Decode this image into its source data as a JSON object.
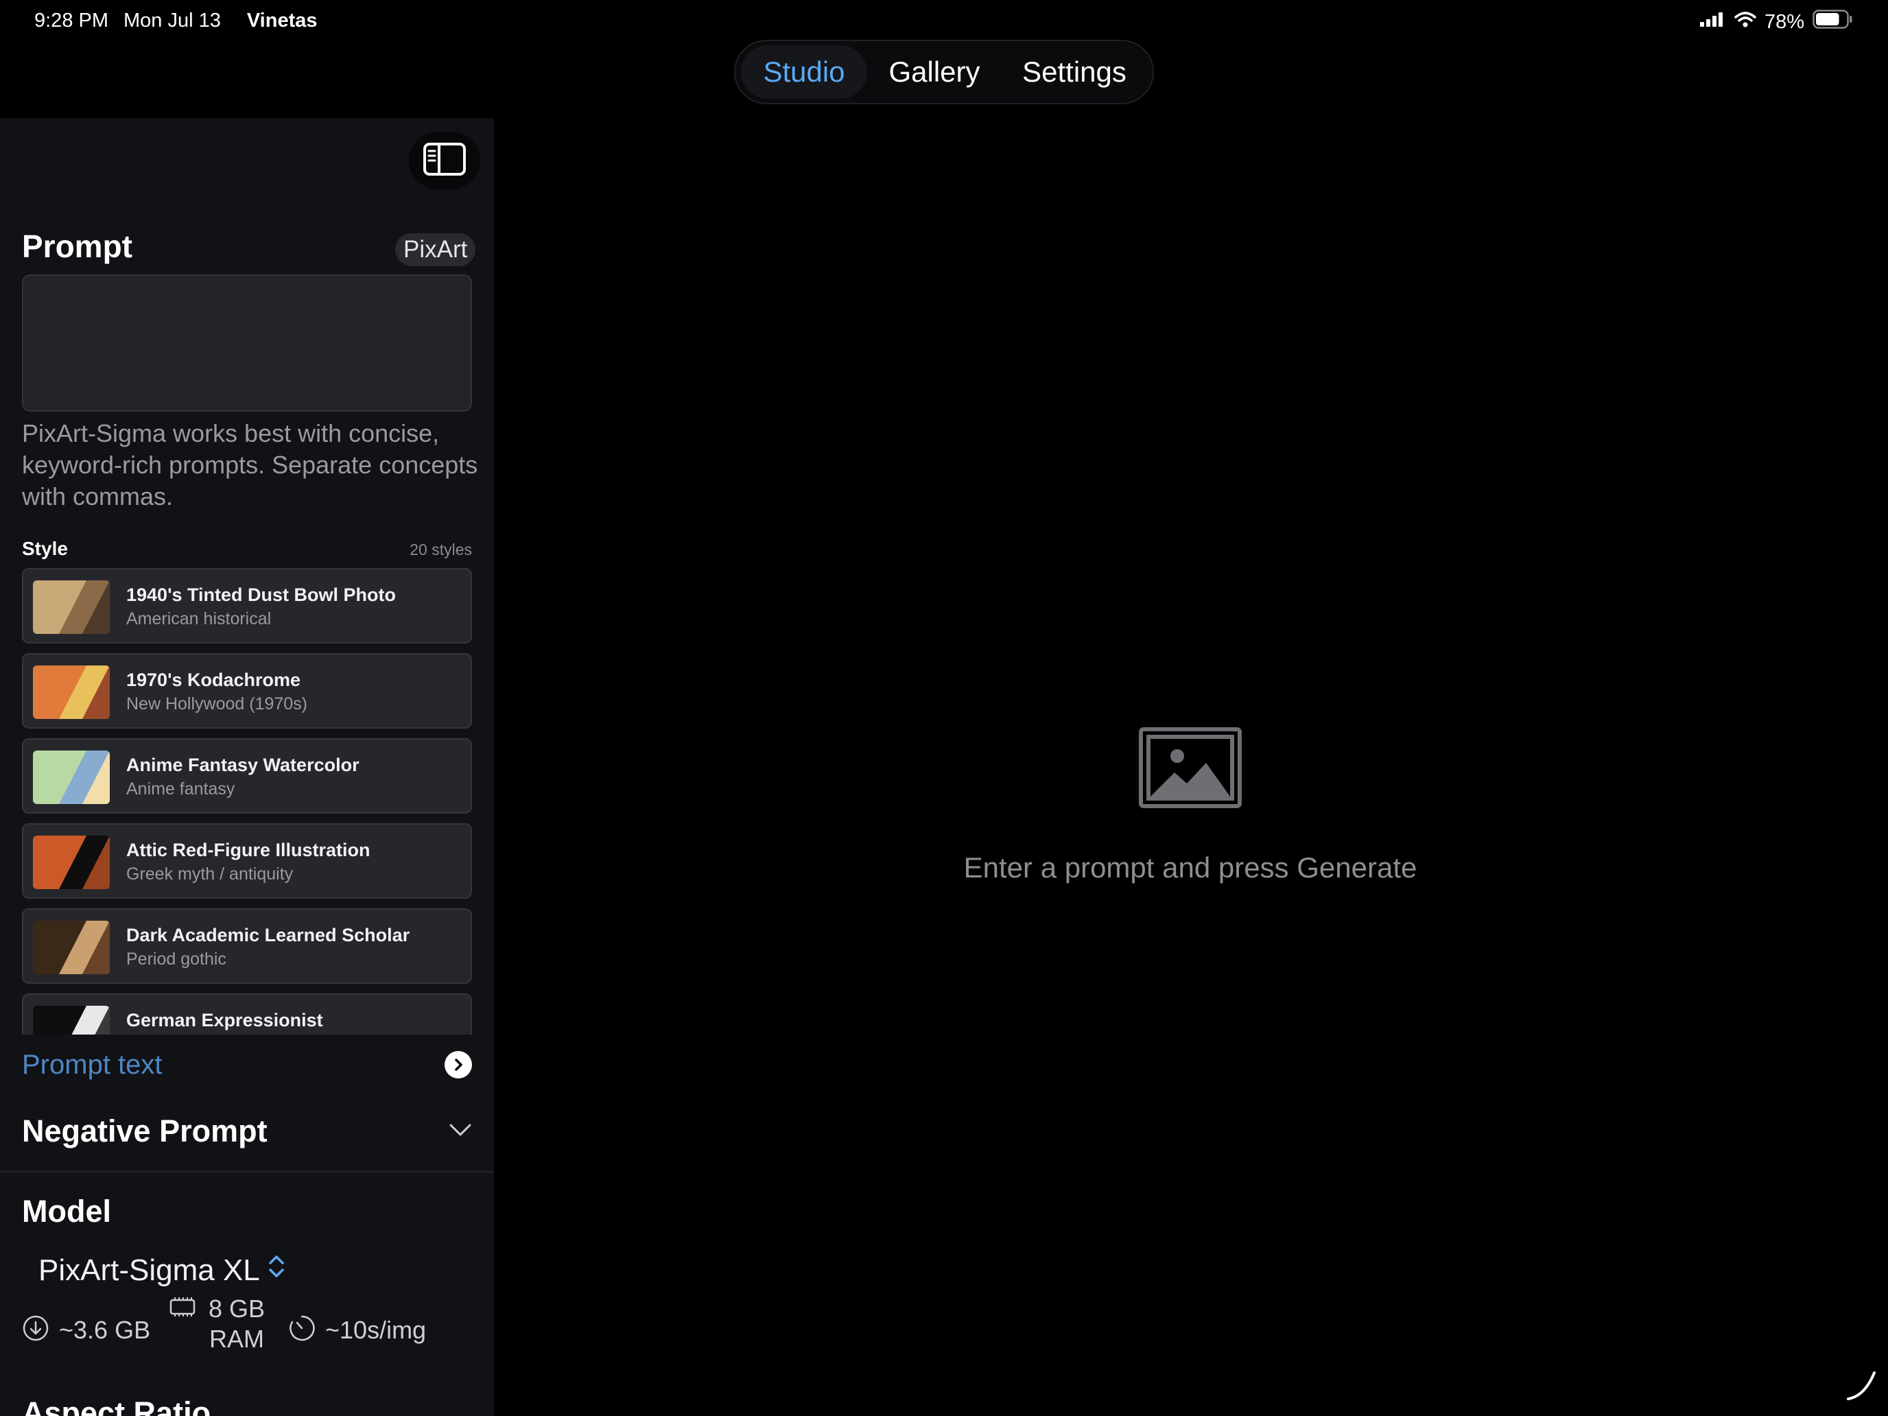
{
  "status_bar": {
    "time": "9:28 PM",
    "date": "Mon Jul 13",
    "app": "Vinetas",
    "battery": "78%",
    "battery_level": 0.78
  },
  "nav": {
    "tabs": [
      {
        "label": "Studio",
        "active": true
      },
      {
        "label": "Gallery",
        "active": false
      },
      {
        "label": "Settings",
        "active": false
      }
    ]
  },
  "sidebar": {
    "prompt": {
      "title": "Prompt",
      "badge": "PixArt",
      "value": "",
      "placeholder": "",
      "hint": "PixArt-Sigma works best with concise, keyword-rich prompts. Separate concepts with commas."
    },
    "style": {
      "label": "Style",
      "count": "20 styles",
      "items": [
        {
          "name": "1940's Tinted Dust Bowl Photo",
          "subtitle": "American historical",
          "colors": [
            "#c9a878",
            "#8a6a48",
            "#4e3a28"
          ]
        },
        {
          "name": "1970's Kodachrome",
          "subtitle": "New Hollywood (1970s)",
          "colors": [
            "#e07b3c",
            "#e8c05c",
            "#9a4a2a"
          ]
        },
        {
          "name": "Anime Fantasy Watercolor",
          "subtitle": "Anime fantasy",
          "colors": [
            "#b9d9a4",
            "#88acd0",
            "#f3ddaa"
          ]
        },
        {
          "name": "Attic Red-Figure Illustration",
          "subtitle": "Greek myth / antiquity",
          "colors": [
            "#cc5a28",
            "#0e0e0e",
            "#9a4420"
          ]
        },
        {
          "name": "Dark Academic Learned Scholar",
          "subtitle": "Period gothic",
          "colors": [
            "#3a2818",
            "#caa070",
            "#6a4428"
          ]
        },
        {
          "name": "German Expressionist",
          "subtitle": "",
          "colors": [
            "#0e0e0e",
            "#e8e8e8",
            "#3a3a3a"
          ]
        }
      ]
    },
    "prompt_text": {
      "label": "Prompt text"
    },
    "negative_prompt": {
      "label": "Negative Prompt"
    },
    "model": {
      "title": "Model",
      "selected": "PixArt-Sigma XL",
      "download_size": "~3.6 GB",
      "ram": "8 GB RAM",
      "speed": "~10s/img"
    },
    "aspect_ratio": {
      "title": "Aspect Ratio"
    }
  },
  "main": {
    "empty_message": "Enter a prompt and press Generate"
  },
  "colors": {
    "accent": "#5aa9f2",
    "link": "#4d87c4",
    "sidebar_bg": "#111216",
    "card_bg": "#26272b"
  }
}
